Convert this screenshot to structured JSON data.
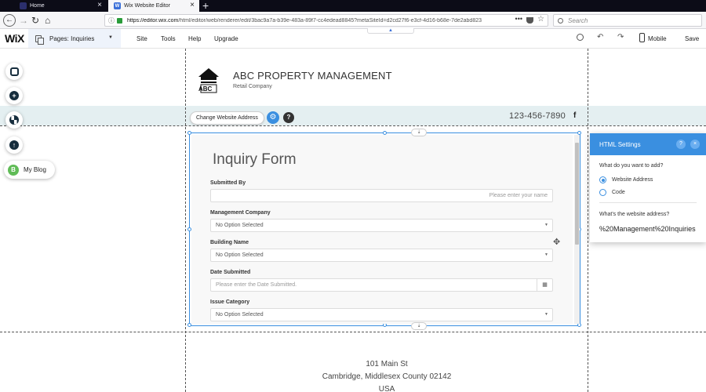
{
  "browser": {
    "tabs": [
      {
        "title": "Home"
      },
      {
        "title": "Wix Website Editor"
      }
    ],
    "new_tab": "+",
    "url_domain": "https://editor.wix.com",
    "url_rest": "/html/editor/web/renderer/edit/3bac9a7a-b39e-483a-89f7-cc4edead8845?metaSiteId=d2cd27f6-e3cf-4d16-b68e-7de2abd823",
    "url_dots": "•••",
    "search_placeholder": "Search"
  },
  "wix_toolbar": {
    "logo": "WiX",
    "pages_label": "Pages: Inquiries",
    "menu": [
      "Site",
      "Tools",
      "Help",
      "Upgrade"
    ],
    "mobile_label": "Mobile",
    "save_label": "Save"
  },
  "site": {
    "company_name": "ABC PROPERTY MANAGEMENT",
    "company_sub": "Retail Company",
    "logo_text": "ABC",
    "phone": "123-456-7890",
    "facebook_icon": "f",
    "footer_lines": [
      "101 Main St",
      "Cambridge, Middlesex County 02142",
      "USA"
    ]
  },
  "element_toolbar": {
    "change_address_label": "Change Website Address",
    "help": "?"
  },
  "form": {
    "title": "Inquiry Form",
    "fields": [
      {
        "label": "Submitted By",
        "value": "Please enter your name"
      },
      {
        "label": "Management Company",
        "value": "No Option Selected"
      },
      {
        "label": "Building Name",
        "value": "No Option Selected"
      },
      {
        "label": "Date Submitted",
        "value": "Please enter the Date Submitted."
      },
      {
        "label": "Issue Category",
        "value": "No Option Selected"
      }
    ]
  },
  "left_rail": {
    "blog_label": "My Blog"
  },
  "html_settings": {
    "title": "HTML Settings",
    "help": "?",
    "close": "×",
    "question": "What do you want to add?",
    "options": [
      {
        "label": "Website Address",
        "selected": true
      },
      {
        "label": "Code",
        "selected": false
      }
    ],
    "address_question": "What's the website address?",
    "address_value": "%20Management%20Inquiries"
  },
  "colors": {
    "accent": "#3a8fe0",
    "strip": "#e4eff1",
    "rail_icon": "#162d3d",
    "blog_green": "#60bc57"
  }
}
